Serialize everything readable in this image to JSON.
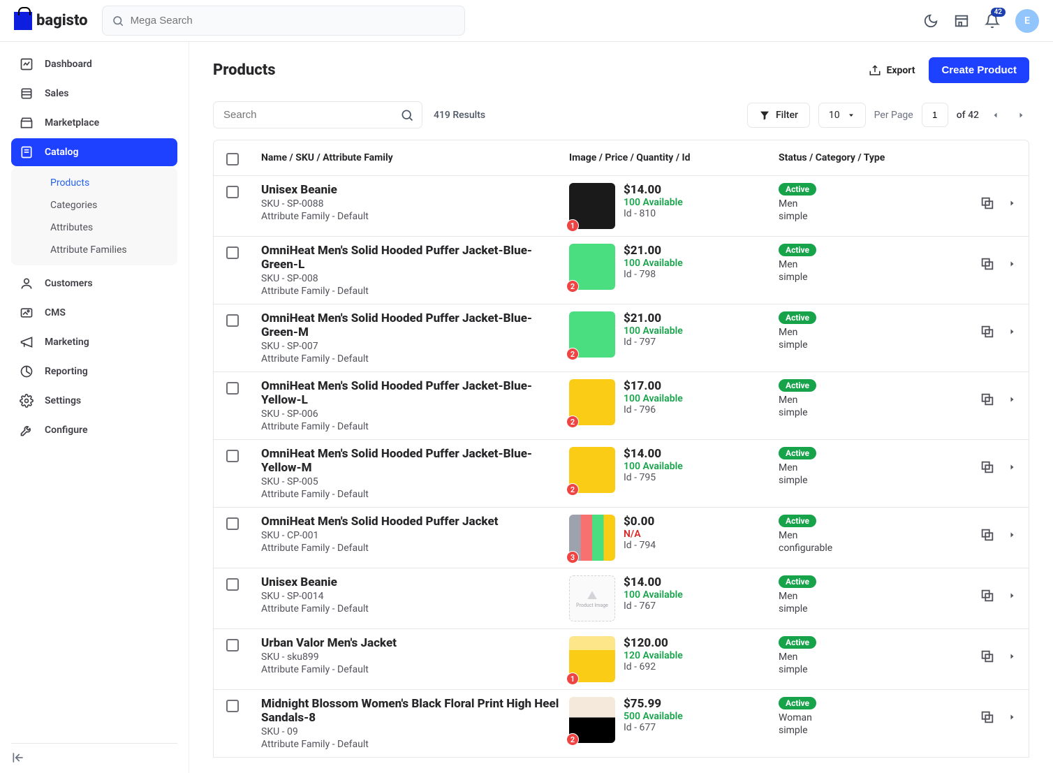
{
  "brand": "bagisto",
  "search": {
    "placeholder": "Mega Search"
  },
  "notifications": {
    "count": 42
  },
  "avatar_initial": "E",
  "sidebar": {
    "items": [
      {
        "label": "Dashboard",
        "icon": "dashboard"
      },
      {
        "label": "Sales",
        "icon": "sales"
      },
      {
        "label": "Marketplace",
        "icon": "marketplace"
      },
      {
        "label": "Catalog",
        "icon": "catalog",
        "active": true,
        "children": [
          {
            "label": "Products",
            "active": true
          },
          {
            "label": "Categories"
          },
          {
            "label": "Attributes"
          },
          {
            "label": "Attribute Families"
          }
        ]
      },
      {
        "label": "Customers",
        "icon": "customers"
      },
      {
        "label": "CMS",
        "icon": "cms"
      },
      {
        "label": "Marketing",
        "icon": "marketing"
      },
      {
        "label": "Reporting",
        "icon": "reporting"
      },
      {
        "label": "Settings",
        "icon": "settings"
      },
      {
        "label": "Configure",
        "icon": "configure"
      }
    ]
  },
  "page": {
    "title": "Products",
    "export_label": "Export",
    "create_label": "Create Product"
  },
  "toolbar": {
    "search_placeholder": "Search",
    "results": "419 Results",
    "filter_label": "Filter",
    "per_page_value": "10",
    "per_page_label": "Per Page",
    "page_value": "1",
    "of_text": "of 42"
  },
  "table": {
    "head_name": "Name / SKU / Attribute Family",
    "head_image": "Image / Price / Quantity / Id",
    "head_status": "Status / Category / Type",
    "rows": [
      {
        "name": "Unisex Beanie",
        "sku": "SKU - SP-0088",
        "attr": "Attribute Family - Default",
        "badge": "1",
        "thumb": "c-black",
        "price": "$14.00",
        "avail": "100 Available",
        "pid": "Id - 810",
        "status": "Active",
        "cat": "Men",
        "type": "simple"
      },
      {
        "name": "OmniHeat Men's Solid Hooded Puffer Jacket-Blue-Green-L",
        "sku": "SKU - SP-008",
        "attr": "Attribute Family - Default",
        "badge": "2",
        "thumb": "c-green",
        "price": "$21.00",
        "avail": "100 Available",
        "pid": "Id - 798",
        "status": "Active",
        "cat": "Men",
        "type": "simple"
      },
      {
        "name": "OmniHeat Men's Solid Hooded Puffer Jacket-Blue-Green-M",
        "sku": "SKU - SP-007",
        "attr": "Attribute Family - Default",
        "badge": "2",
        "thumb": "c-green",
        "price": "$21.00",
        "avail": "100 Available",
        "pid": "Id - 797",
        "status": "Active",
        "cat": "Men",
        "type": "simple"
      },
      {
        "name": "OmniHeat Men's Solid Hooded Puffer Jacket-Blue-Yellow-L",
        "sku": "SKU - SP-006",
        "attr": "Attribute Family - Default",
        "badge": "2",
        "thumb": "c-yellow",
        "price": "$17.00",
        "avail": "100 Available",
        "pid": "Id - 796",
        "status": "Active",
        "cat": "Men",
        "type": "simple"
      },
      {
        "name": "OmniHeat Men's Solid Hooded Puffer Jacket-Blue-Yellow-M",
        "sku": "SKU - SP-005",
        "attr": "Attribute Family - Default",
        "badge": "2",
        "thumb": "c-yellow",
        "price": "$14.00",
        "avail": "100 Available",
        "pid": "Id - 795",
        "status": "Active",
        "cat": "Men",
        "type": "simple"
      },
      {
        "name": "OmniHeat Men's Solid Hooded Puffer Jacket",
        "sku": "SKU - CP-001",
        "attr": "Attribute Family - Default",
        "badge": "3",
        "thumb": "c-multi",
        "price": "$0.00",
        "avail": "N/A",
        "avail_na": true,
        "pid": "Id - 794",
        "status": "Active",
        "cat": "Men",
        "type": "configurable"
      },
      {
        "name": "Unisex Beanie",
        "sku": "SKU - SP-0014",
        "attr": "Attribute Family - Default",
        "badge": "",
        "thumb": "placeholder",
        "price": "$14.00",
        "avail": "100 Available",
        "pid": "Id - 767",
        "status": "Active",
        "cat": "Men",
        "type": "simple"
      },
      {
        "name": "Urban Valor Men's Jacket",
        "sku": "SKU - sku899",
        "attr": "Attribute Family - Default",
        "badge": "1",
        "thumb": "c-peach",
        "price": "$120.00",
        "avail": "120 Available",
        "pid": "Id - 692",
        "status": "Active",
        "cat": "Men",
        "type": "simple"
      },
      {
        "name": "Midnight Blossom Women's Black Floral Print High Heel Sandals-8",
        "sku": "SKU - 09",
        "attr": "Attribute Family - Default",
        "badge": "2",
        "thumb": "c-shoe",
        "price": "$75.99",
        "avail": "500 Available",
        "pid": "Id - 677",
        "status": "Active",
        "cat": "Woman",
        "type": "simple"
      }
    ]
  },
  "placeholder_text": "Product Image"
}
